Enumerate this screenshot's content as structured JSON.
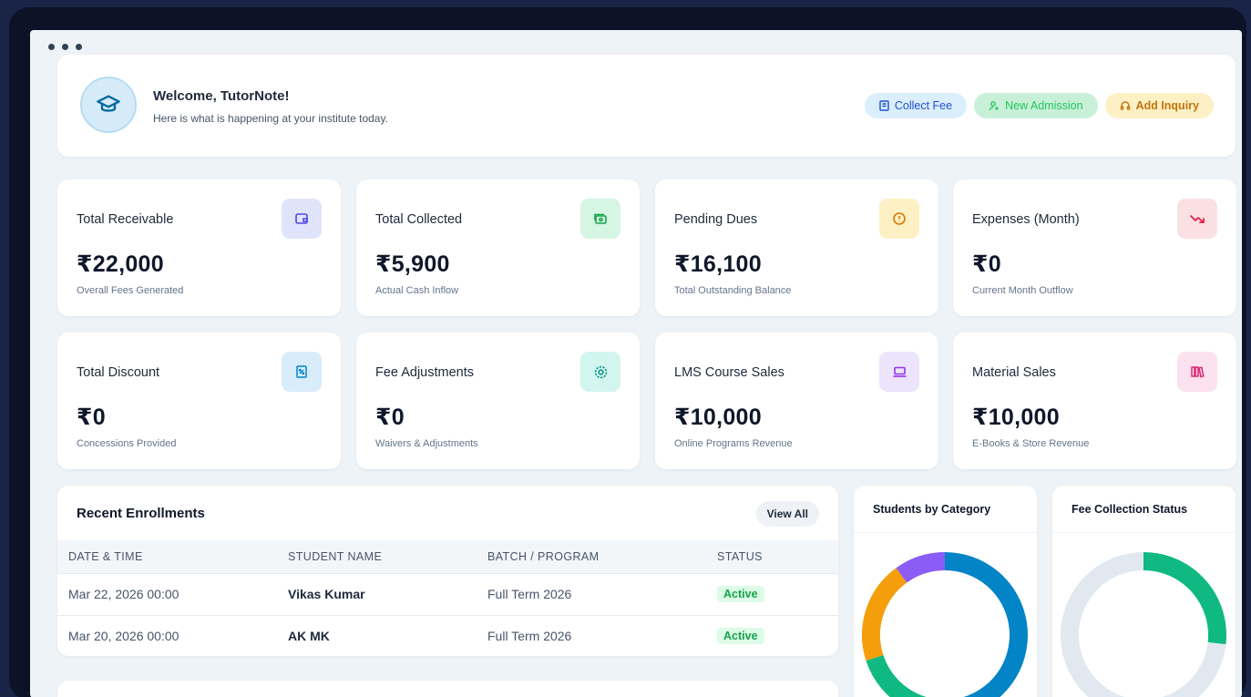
{
  "welcome": {
    "title": "Welcome, TutorNote!",
    "subtitle": "Here is what is happening at your institute today.",
    "icon": "graduation-cap-icon"
  },
  "actions": {
    "collect_fee": "Collect Fee",
    "new_admission": "New Admission",
    "add_inquiry": "Add Inquiry"
  },
  "stats": [
    {
      "label": "Total Receivable",
      "value": "₹22,000",
      "sub": "Overall Fees Generated",
      "icon": "wallet-icon",
      "bg": "#dfe4fb",
      "color": "#4f46e5"
    },
    {
      "label": "Total Collected",
      "value": "₹5,900",
      "sub": "Actual Cash Inflow",
      "icon": "cash-icon",
      "bg": "#d6f5e2",
      "color": "#16a34a"
    },
    {
      "label": "Pending Dues",
      "value": "₹16,100",
      "sub": "Total Outstanding Balance",
      "icon": "alert-circle-icon",
      "bg": "#fdf0c4",
      "color": "#d97706"
    },
    {
      "label": "Expenses (Month)",
      "value": "₹0",
      "sub": "Current Month Outflow",
      "icon": "trending-down-icon",
      "bg": "#fbe0e3",
      "color": "#e11d48"
    },
    {
      "label": "Total Discount",
      "value": "₹0",
      "sub": "Concessions Provided",
      "icon": "receipt-percent-icon",
      "bg": "#d8ecfa",
      "color": "#0284c7"
    },
    {
      "label": "Fee Adjustments",
      "value": "₹0",
      "sub": "Waivers & Adjustments",
      "icon": "gear-icon",
      "bg": "#d2f5ef",
      "color": "#0d9488"
    },
    {
      "label": "LMS Course Sales",
      "value": "₹10,000",
      "sub": "Online Programs Revenue",
      "icon": "laptop-icon",
      "bg": "#ece3fc",
      "color": "#9333ea"
    },
    {
      "label": "Material Sales",
      "value": "₹10,000",
      "sub": "E-Books & Store Revenue",
      "icon": "books-icon",
      "bg": "#fce1ee",
      "color": "#db2777"
    }
  ],
  "enrollments": {
    "title": "Recent Enrollments",
    "view_all": "View All",
    "columns": [
      "DATE & TIME",
      "STUDENT NAME",
      "BATCH / PROGRAM",
      "STATUS"
    ],
    "rows": [
      {
        "date": "Mar 22, 2026 00:00",
        "name": "Vikas Kumar",
        "batch": "Full Term 2026",
        "status": "Active"
      },
      {
        "date": "Mar 20, 2026 00:00",
        "name": "AK MK",
        "batch": "Full Term 2026",
        "status": "Active"
      }
    ]
  },
  "charts": {
    "category_title": "Students by Category",
    "fee_title": "Fee Collection Status"
  },
  "chart_data": [
    {
      "type": "pie",
      "title": "Students by Category",
      "values": [
        45,
        25,
        20,
        10
      ],
      "colors": [
        "#0284c7",
        "#10b981",
        "#f59e0b",
        "#8b5cf6"
      ]
    },
    {
      "type": "pie",
      "title": "Fee Collection Status",
      "values": [
        26.8,
        73.2
      ],
      "colors": [
        "#10b981",
        "#e2e8f0"
      ]
    }
  ]
}
